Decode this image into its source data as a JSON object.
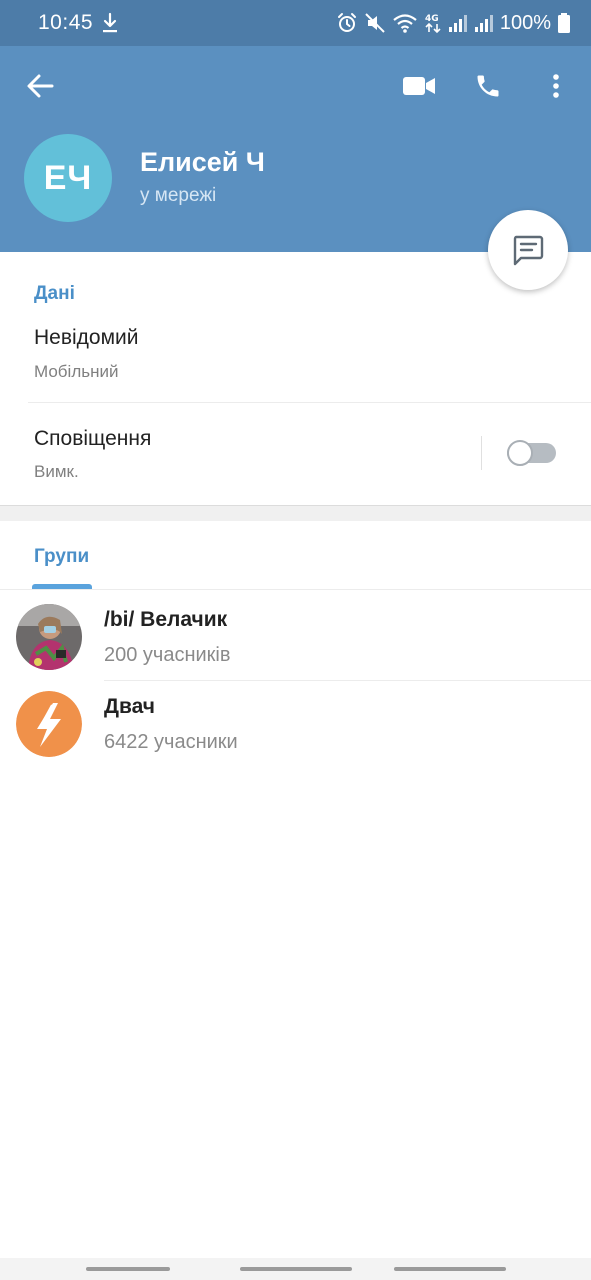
{
  "status_bar": {
    "time": "10:45",
    "battery_percent": "100%",
    "icons": [
      "download-icon",
      "alarm-icon",
      "mute-icon",
      "wifi-icon",
      "4g-icon",
      "signal-icon",
      "signal-icon",
      "battery-icon"
    ]
  },
  "header": {
    "avatar_initials": "ЕЧ",
    "name": "Елисей Ч",
    "status": "у мережі",
    "icons": [
      "back-arrow-icon",
      "video-call-icon",
      "phone-icon",
      "more-vert-icon"
    ]
  },
  "colors": {
    "status_bar_bg": "#4d7ca8",
    "header_bg": "#5b90c0",
    "avatar_bg": "#62c0d9",
    "accent_blue": "#4a8fc8"
  },
  "info": {
    "section_title": "Дані",
    "phone_value": "Невідомий",
    "phone_label": "Мобільний",
    "notifications_title": "Сповіщення",
    "notifications_value": "Вимк.",
    "notifications_enabled": false
  },
  "groups": {
    "section_title": "Групи",
    "items": [
      {
        "name": "/bi/ Велачик",
        "members": "200 учасників"
      },
      {
        "name": "Двач",
        "members": "6422 учасники"
      }
    ]
  }
}
